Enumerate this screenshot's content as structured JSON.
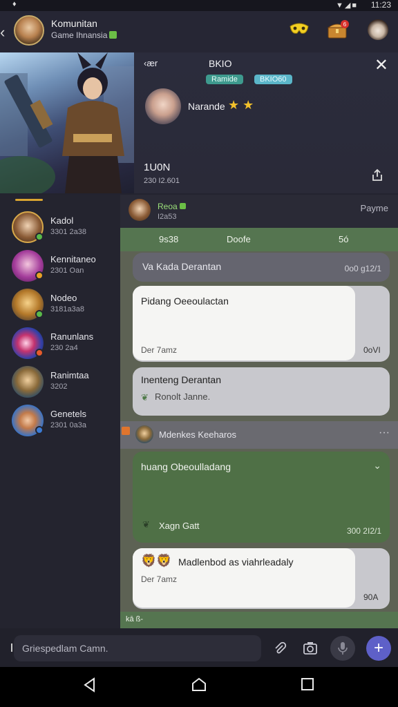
{
  "status": {
    "time": "11:23"
  },
  "top": {
    "title": "Komunitan",
    "subtitle": "Game Ihnansia"
  },
  "banner": {
    "tag_back": "‹ær",
    "name": "BKIO",
    "badge1": "Ramide",
    "badge2": "BKIO60",
    "user_name": "Narande",
    "count": "1U0N",
    "count_sub": "230 I2.601"
  },
  "sidebar": {
    "items": [
      {
        "name": "Kadol",
        "count": "3301 2a38"
      },
      {
        "name": "Kennitaneo",
        "count": "2301 Oan"
      },
      {
        "name": "Nodeo",
        "count": "3181a3a8"
      },
      {
        "name": "Ranunlans",
        "count": "230 2a4"
      },
      {
        "name": "Ranimtaa",
        "count": "3202"
      },
      {
        "name": "Genetels",
        "count": "2301 0a3a"
      }
    ]
  },
  "chat": {
    "head_name": "Reoa",
    "head_sub": "I2a53",
    "head_right": "Payme",
    "tabs": [
      "9s38",
      "Doofe",
      "5ó"
    ],
    "m1_text": "Va Kada Derantan",
    "m1_time": "0o0 g12/1",
    "m2_text": "Pidang Oeeoulactan",
    "m2_sub": "Der 7amz",
    "m2_time": "0oVI",
    "m3_text": "Inenteng Derantan",
    "m3_sub": "Ronolt Janne.",
    "group_name": "Mdenkes Keeharos",
    "m4_text": "huang Obeoulladang",
    "m4_sub": "Xagn Gatt",
    "m4_time": "300 2I2/1",
    "m5_text": "Madlenbod as viahrleadaly",
    "m5_sub": "Der 7amz",
    "m5_time": "90A",
    "footer": "kā ß-"
  },
  "input": {
    "placeholder": "Griespedlam Camn."
  },
  "colors": {
    "accent": "#5e60c8",
    "green": "#557550",
    "dark": "#23232f"
  }
}
